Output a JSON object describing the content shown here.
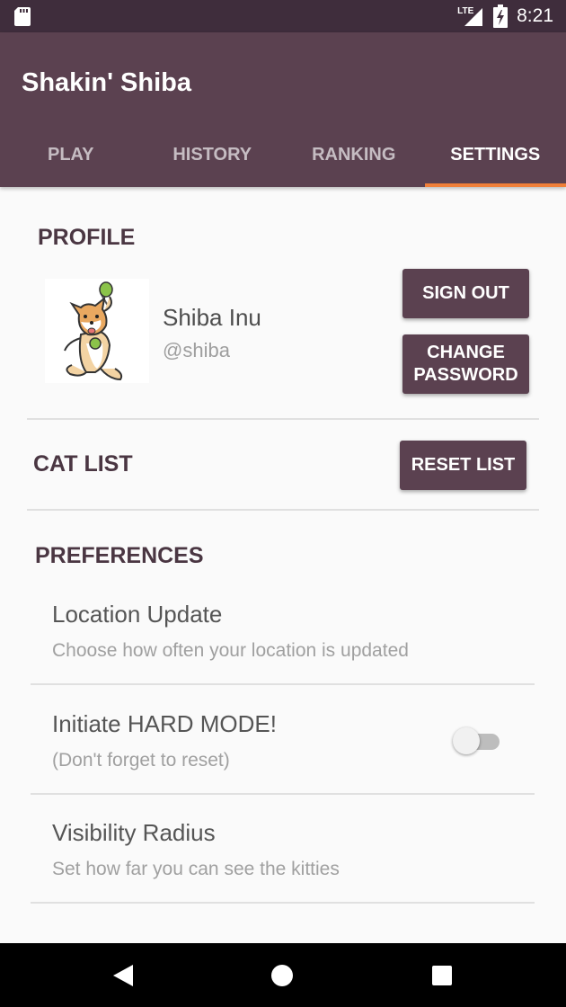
{
  "status_bar": {
    "network_label": "LTE",
    "time": "8:21"
  },
  "app": {
    "title": "Shakin' Shiba"
  },
  "tabs": [
    {
      "label": "PLAY",
      "active": false
    },
    {
      "label": "HISTORY",
      "active": false
    },
    {
      "label": "RANKING",
      "active": false
    },
    {
      "label": "SETTINGS",
      "active": true
    }
  ],
  "profile": {
    "heading": "PROFILE",
    "name": "Shiba Inu",
    "handle": "@shiba",
    "sign_out_label": "SIGN OUT",
    "change_password_label": "CHANGE PASSWORD"
  },
  "cat_list": {
    "heading": "CAT LIST",
    "reset_label": "RESET LIST"
  },
  "preferences": {
    "heading": "PREFERENCES",
    "items": [
      {
        "title": "Location Update",
        "subtitle": "Choose how often your location is updated"
      },
      {
        "title": "Initiate HARD MODE!",
        "subtitle": "(Don't forget to reset)",
        "toggle_on": false
      },
      {
        "title": "Visibility Radius",
        "subtitle": "Set how far you can see the kitties"
      }
    ]
  },
  "icons": {
    "status_left": "sd-card-icon",
    "signal": "signal-icon",
    "battery": "battery-charging-icon",
    "nav_back": "back-triangle-icon",
    "nav_home": "home-circle-icon",
    "nav_recents": "recents-square-icon"
  },
  "colors": {
    "primary": "#5b4150",
    "primary_dark": "#3f2d3c",
    "accent": "#f07f39",
    "heading": "#4a3642"
  }
}
